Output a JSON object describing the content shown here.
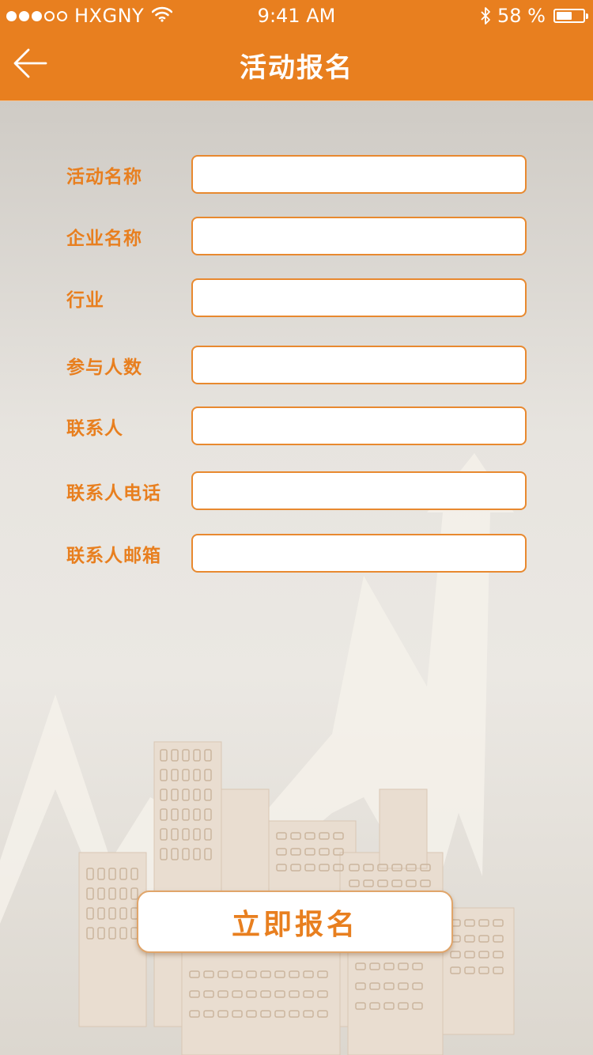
{
  "status_bar": {
    "carrier": "HXGNY",
    "time": "9:41 AM",
    "battery": "58 %",
    "battery_level": 0.58,
    "signal_icon": "signal-dots-icon",
    "wifi_icon": "wifi-icon",
    "bluetooth_icon": "bluetooth-icon"
  },
  "nav": {
    "title": "活动报名",
    "back_icon": "arrow-left-icon"
  },
  "form": {
    "fields": [
      {
        "label": "活动名称",
        "value": "",
        "placeholder": ""
      },
      {
        "label": "企业名称",
        "value": "",
        "placeholder": ""
      },
      {
        "label": "行业",
        "value": "",
        "placeholder": ""
      },
      {
        "label": "参与人数",
        "value": "",
        "placeholder": ""
      },
      {
        "label": "联系人",
        "value": "",
        "placeholder": ""
      },
      {
        "label": "联系人电话",
        "value": "",
        "placeholder": ""
      },
      {
        "label": "联系人邮箱",
        "value": "",
        "placeholder": ""
      }
    ],
    "submit_label": "立即报名"
  },
  "colors": {
    "brand": "#e87f1f",
    "input_border": "#e8892f",
    "background": "#e4e0da"
  }
}
